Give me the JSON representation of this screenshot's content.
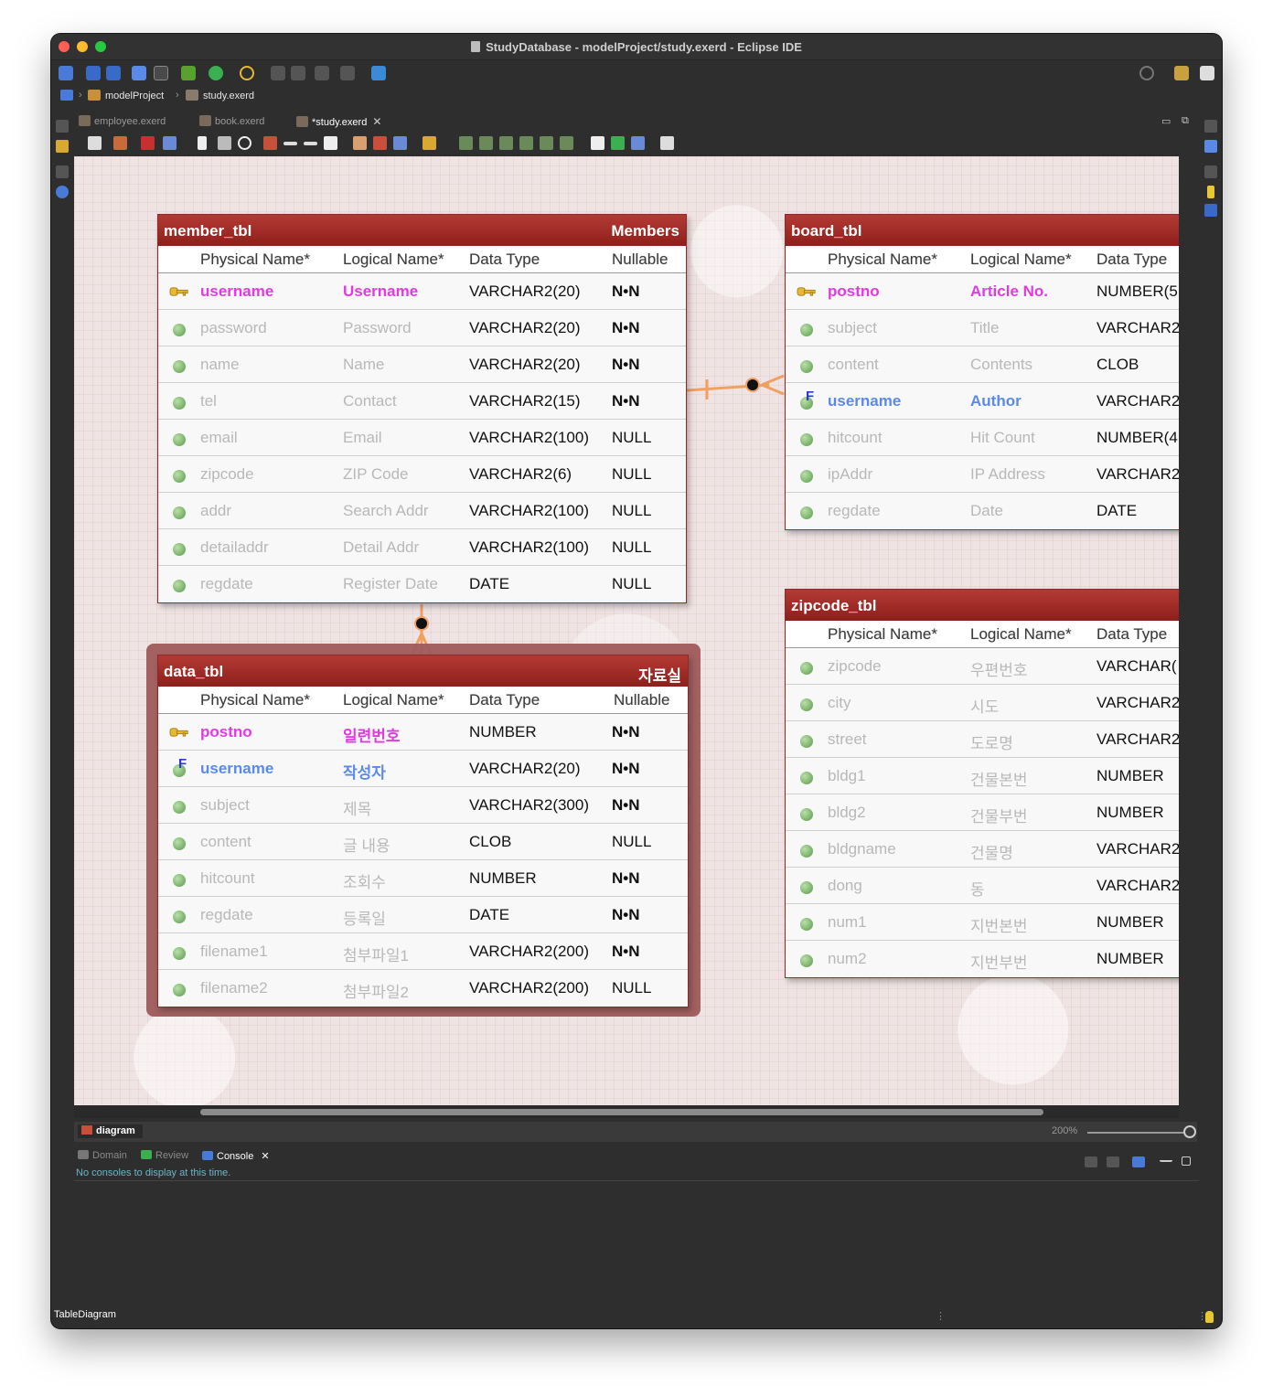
{
  "window": {
    "title": "StudyDatabase - modelProject/study.exerd - Eclipse IDE"
  },
  "breadcrumb": {
    "project": "modelProject",
    "file": "study.exerd"
  },
  "editor_tabs": [
    {
      "label": "employee.exerd"
    },
    {
      "label": "book.exerd"
    },
    {
      "label": "*study.exerd"
    }
  ],
  "column_headers": {
    "physical": "Physical Name*",
    "logical": "Logical Name*",
    "type": "Data Type",
    "nullable": "Nullable"
  },
  "entities": {
    "member": {
      "name": "member_tbl",
      "logical": "Members",
      "rows": [
        {
          "physical": "username",
          "logical": "Username",
          "type": "VARCHAR2(20)",
          "nullable": "N•N",
          "kind": "pk"
        },
        {
          "physical": "password",
          "logical": "Password",
          "type": "VARCHAR2(20)",
          "nullable": "N•N",
          "kind": "col"
        },
        {
          "physical": "name",
          "logical": "Name",
          "type": "VARCHAR2(20)",
          "nullable": "N•N",
          "kind": "col"
        },
        {
          "physical": "tel",
          "logical": "Contact",
          "type": "VARCHAR2(15)",
          "nullable": "N•N",
          "kind": "col"
        },
        {
          "physical": "email",
          "logical": "Email",
          "type": "VARCHAR2(100)",
          "nullable": "NULL",
          "kind": "col"
        },
        {
          "physical": "zipcode",
          "logical": "ZIP Code",
          "type": "VARCHAR2(6)",
          "nullable": "NULL",
          "kind": "col"
        },
        {
          "physical": "addr",
          "logical": "Search Addr",
          "type": "VARCHAR2(100)",
          "nullable": "NULL",
          "kind": "col"
        },
        {
          "physical": "detailaddr",
          "logical": "Detail Addr",
          "type": "VARCHAR2(100)",
          "nullable": "NULL",
          "kind": "col"
        },
        {
          "physical": "regdate",
          "logical": "Register Date",
          "type": "DATE",
          "nullable": "NULL",
          "kind": "col"
        }
      ]
    },
    "board": {
      "name": "board_tbl",
      "rows": [
        {
          "physical": "postno",
          "logical": "Article No.",
          "type": "NUMBER(5",
          "kind": "pk"
        },
        {
          "physical": "subject",
          "logical": "Title",
          "type": "VARCHAR2",
          "kind": "col"
        },
        {
          "physical": "content",
          "logical": "Contents",
          "type": "CLOB",
          "kind": "col"
        },
        {
          "physical": "username",
          "logical": "Author",
          "type": "VARCHAR2",
          "kind": "fk"
        },
        {
          "physical": "hitcount",
          "logical": "Hit Count",
          "type": "NUMBER(4",
          "kind": "col"
        },
        {
          "physical": "ipAddr",
          "logical": "IP Address",
          "type": "VARCHAR2",
          "kind": "col"
        },
        {
          "physical": "regdate",
          "logical": "Date",
          "type": "DATE",
          "kind": "col"
        }
      ]
    },
    "data": {
      "name": "data_tbl",
      "logical": "자료실",
      "rows": [
        {
          "physical": "postno",
          "logical": "일련번호",
          "type": "NUMBER",
          "nullable": "N•N",
          "kind": "pk"
        },
        {
          "physical": "username",
          "logical": "작성자",
          "type": "VARCHAR2(20)",
          "nullable": "N•N",
          "kind": "fk"
        },
        {
          "physical": "subject",
          "logical": "제목",
          "type": "VARCHAR2(300)",
          "nullable": "N•N",
          "kind": "col"
        },
        {
          "physical": "content",
          "logical": "글 내용",
          "type": "CLOB",
          "nullable": "NULL",
          "kind": "col"
        },
        {
          "physical": "hitcount",
          "logical": "조회수",
          "type": "NUMBER",
          "nullable": "N•N",
          "kind": "col"
        },
        {
          "physical": "regdate",
          "logical": "등록일",
          "type": "DATE",
          "nullable": "N•N",
          "kind": "col"
        },
        {
          "physical": "filename1",
          "logical": "첨부파일1",
          "type": "VARCHAR2(200)",
          "nullable": "N•N",
          "kind": "col"
        },
        {
          "physical": "filename2",
          "logical": "첨부파일2",
          "type": "VARCHAR2(200)",
          "nullable": "NULL",
          "kind": "col"
        }
      ]
    },
    "zipcode": {
      "name": "zipcode_tbl",
      "rows": [
        {
          "physical": "zipcode",
          "logical": "우편번호",
          "type": "VARCHAR(",
          "kind": "col"
        },
        {
          "physical": "city",
          "logical": "시도",
          "type": "VARCHAR2",
          "kind": "col"
        },
        {
          "physical": "street",
          "logical": "도로명",
          "type": "VARCHAR2",
          "kind": "col"
        },
        {
          "physical": "bldg1",
          "logical": "건물본번",
          "type": "NUMBER",
          "kind": "col"
        },
        {
          "physical": "bldg2",
          "logical": "건물부번",
          "type": "NUMBER",
          "kind": "col"
        },
        {
          "physical": "bldgname",
          "logical": "건물명",
          "type": "VARCHAR2",
          "kind": "col"
        },
        {
          "physical": "dong",
          "logical": "동",
          "type": "VARCHAR2",
          "kind": "col"
        },
        {
          "physical": "num1",
          "logical": "지번본번",
          "type": "NUMBER",
          "kind": "col"
        },
        {
          "physical": "num2",
          "logical": "지번부번",
          "type": "NUMBER",
          "kind": "col"
        }
      ]
    }
  },
  "diagram_tab": {
    "label": "diagram",
    "zoom": "200%"
  },
  "bottom_tabs": [
    {
      "label": "Domain"
    },
    {
      "label": "Review"
    },
    {
      "label": "Console"
    }
  ],
  "console": {
    "message": "No consoles to display at this time."
  },
  "status": {
    "text": "TableDiagram"
  },
  "colors": {
    "pk": "#e03be0",
    "fk": "#5a8ae8",
    "header": "#a02a26",
    "relation": "#f0a060"
  }
}
